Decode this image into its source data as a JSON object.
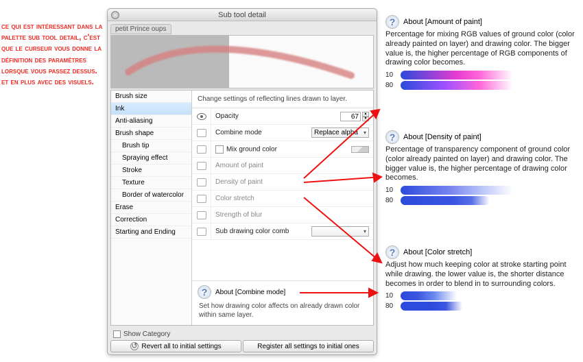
{
  "french_text": "Ce qui est intéressant dans la palette Sub tool detail, c'est que le curseur vous donne la définition des paramètres lorsque vous passez dessus. Et en plus avec des visuels.",
  "panel": {
    "title": "Sub tool detail",
    "brush_name": "petit Prince oups",
    "categories": [
      "Brush size",
      "Ink",
      "Anti-aliasing",
      "Brush shape",
      "Brush tip",
      "Spraying effect",
      "Stroke",
      "Texture",
      "Border of watercolor",
      "Erase",
      "Correction",
      "Starting and Ending"
    ],
    "selected_category_index": 1,
    "sub_indices": [
      4,
      5,
      6,
      7,
      8
    ],
    "description": "Change settings of reflecting lines drawn to layer.",
    "rows": {
      "opacity": {
        "label": "Opacity",
        "value": "67"
      },
      "combine_mode": {
        "label": "Combine mode",
        "value": "Replace alpha"
      },
      "mix_ground": {
        "label": "Mix ground color"
      },
      "amount_paint": {
        "label": "Amount of paint"
      },
      "density_paint": {
        "label": "Density of paint"
      },
      "color_stretch": {
        "label": "Color stretch"
      },
      "strength_blur": {
        "label": "Strength of blur"
      },
      "sub_drawing": {
        "label": "Sub drawing color comb"
      }
    },
    "about_box": {
      "title": "About [Combine mode]",
      "body": "Set how drawing color affects on already drawn color within same layer."
    },
    "show_category": "Show Category",
    "revert_btn": "Revert all to initial settings",
    "register_btn": "Register all settings to initial ones"
  },
  "help": {
    "amount": {
      "title": "About [Amount of paint]",
      "body": "Percentage for mixing RGB values of ground color (color already painted on layer) and drawing color. The bigger value is, the higher percentage of RGB components of drawing color becomes.",
      "v1": "10",
      "v2": "80"
    },
    "density": {
      "title": "About [Density of paint]",
      "body": "Percentage of transparency component of ground color (color already painted on layer) and drawing color. The bigger value is, the higher percentage of drawing color becomes.",
      "v1": "10",
      "v2": "80"
    },
    "stretch": {
      "title": "About [Color stretch]",
      "body": "Adjust how much keeping color at stroke starting point while drawing. the lower value is, the shorter distance becomes in order to blend in to surrounding colors.",
      "v1": "10",
      "v2": "80"
    }
  }
}
